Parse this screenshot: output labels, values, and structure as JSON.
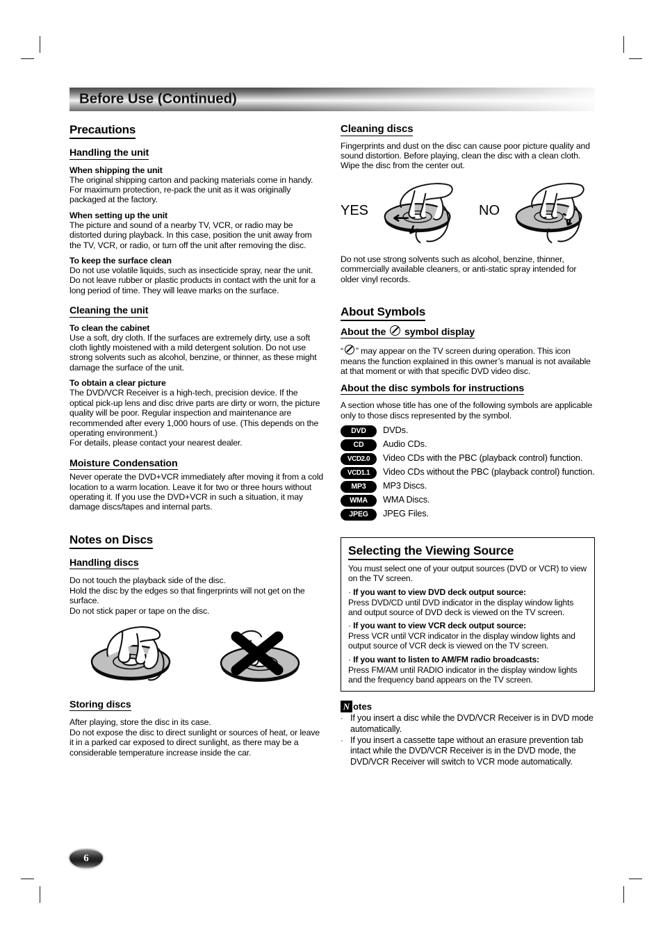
{
  "banner": {
    "title": "Before Use (Continued)"
  },
  "page_number": "6",
  "left": {
    "precautions": {
      "heading": "Precautions",
      "handling_heading": "Handling the unit",
      "blocks": [
        {
          "title": "When shipping the unit",
          "text": "The original shipping carton and packing materials come in handy. For maximum protection, re-pack the unit as it was originally packaged at the factory."
        },
        {
          "title": "When setting  up the unit",
          "text": "The picture and sound of a nearby TV, VCR, or radio may be distorted during playback. In this case, position the unit away from the TV, VCR, or radio, or turn off the unit after removing the disc."
        },
        {
          "title": "To keep the surface clean",
          "text": "Do not use volatile liquids, such as insecticide spray, near the unit. Do not leave rubber or plastic products in contact with the unit for a long period of time. They will leave marks on the surface."
        }
      ],
      "cleaning_heading": "Cleaning the unit",
      "cleaning_blocks": [
        {
          "title": "To clean the cabinet",
          "text": "Use a soft, dry cloth. If the surfaces are extremely dirty, use a soft cloth lightly moistened with a mild detergent solution. Do not use strong solvents such as alcohol, benzine, or thinner, as these might damage the surface of the unit."
        },
        {
          "title": "To obtain a clear picture",
          "text": "The DVD/VCR Receiver is a high-tech, precision device. If the optical pick-up lens and disc drive parts are dirty or worn, the picture quality will be poor. Regular inspection and maintenance are recommended after every 1,000 hours of use. (This depends on the operating environment.)\nFor details, please contact your nearest dealer."
        }
      ],
      "moisture_heading": "Moisture Condensation",
      "moisture_text": "Never operate the DVD+VCR immediately after moving it from a cold location to a warm location. Leave it for two or three hours without operating it. If you use the DVD+VCR in such a situation, it may damage discs/tapes and internal parts."
    },
    "notes_on_discs": {
      "heading": "Notes on Discs",
      "handling_heading": "Handling discs",
      "handling_text": "Do not touch the playback side of the disc.\nHold the disc by the edges so that fingerprints will not get on the surface.\nDo not stick paper or tape on the disc.",
      "storing_heading": "Storing discs",
      "storing_text": "After playing, store the disc in its case.\nDo not expose the disc to direct sunlight or sources of heat, or leave it in a parked car exposed to direct sunlight, as there may be a considerable temperature increase inside the car."
    }
  },
  "right": {
    "cleaning_discs": {
      "heading": "Cleaning discs",
      "text": "Fingerprints and dust on the disc can cause poor picture quality and sound distortion. Before playing, clean the disc with a clean cloth. Wipe the disc from the center out.",
      "yes_label": "YES",
      "no_label": "NO",
      "after_text": "Do not use strong solvents such as alcohol, benzine, thinner, commercially available cleaners, or anti-static spray intended for older vinyl records."
    },
    "about_symbols": {
      "heading": "About Symbols",
      "symbol_display_heading_before": "About the",
      "symbol_display_heading_after": "symbol display",
      "symbol_display_text_1": "“",
      "symbol_display_text_2": "” may appear on the TV screen during operation. This icon means the function explained in this owner’s manual is not available at that moment or with that specific DVD video disc.",
      "disc_symbols_heading": "About the disc symbols for instructions",
      "disc_symbols_intro": "A section whose title has one of the following symbols are applicable only to those discs represented by the symbol.",
      "symbols": [
        {
          "badge": "DVD",
          "text": "DVDs."
        },
        {
          "badge": "CD",
          "text": "Audio CDs."
        },
        {
          "badge": "VCD2.0",
          "text": "Video CDs with the PBC (playback control) function."
        },
        {
          "badge": "VCD1.1",
          "text": "Video CDs without the PBC (playback control) function."
        },
        {
          "badge": "MP3",
          "text": "MP3 Discs."
        },
        {
          "badge": "WMA",
          "text": "WMA Discs."
        },
        {
          "badge": "JPEG",
          "text": "JPEG Files."
        }
      ]
    },
    "viewing_source": {
      "heading": "Selecting the Viewing Source",
      "intro": "You must select one of your output sources (DVD or VCR) to view on the TV screen.",
      "items": [
        {
          "bullet": "·",
          "title": "If you want to view DVD deck output source:",
          "text": "Press DVD/CD until DVD indicator in the display window lights and output source of DVD deck is viewed on the TV screen."
        },
        {
          "bullet": "·",
          "title": "If you want to view VCR deck output source:",
          "text": "Press VCR until VCR indicator in the display window lights and output source of VCR deck is viewed on the TV screen."
        },
        {
          "bullet": "·",
          "title": "If you want to listen to AM/FM radio broadcasts:",
          "text": "Press FM/AM until RADIO indicator in the display window lights and the frequency band appears on the TV screen."
        }
      ]
    },
    "notes": {
      "n_glyph": "N",
      "word": "otes",
      "items": [
        {
          "bullet": "·",
          "text": "If you insert a disc while the DVD/VCR Receiver is in DVD mode automatically."
        },
        {
          "bullet": "·",
          "text": "If you insert a cassette tape without an erasure prevention tab intact while the DVD/VCR Receiver is in the DVD mode, the DVD/VCR Receiver will switch to VCR mode automatically."
        }
      ]
    }
  }
}
